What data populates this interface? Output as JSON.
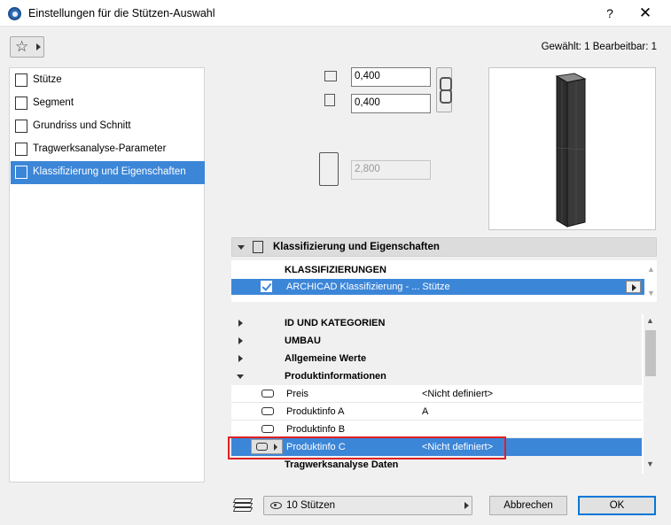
{
  "window": {
    "title": "Einstellungen für die Stützen-Auswahl",
    "help": "?",
    "close": "✕"
  },
  "toolbar": {
    "favorites_icon": "star-icon",
    "selection_info": "Gewählt: 1 Bearbeitbar: 1"
  },
  "nav": {
    "items": [
      {
        "label": "Stütze",
        "icon": "column-icon"
      },
      {
        "label": "Segment",
        "icon": "segment-icon"
      },
      {
        "label": "Grundriss und Schnitt",
        "icon": "floorplan-icon"
      },
      {
        "label": "Tragwerksanalyse-Parameter",
        "icon": "structural-icon"
      },
      {
        "label": "Klassifizierung und Eigenschaften",
        "icon": "classification-icon"
      }
    ],
    "active_index": 4
  },
  "geometry": {
    "width_value": "0,400",
    "depth_value": "0,400",
    "height_value": "2,800"
  },
  "section": {
    "title": "Klassifizierung und Eigenschaften"
  },
  "classification": {
    "header": "KLASSIFIZIERUNGEN",
    "row_label": "ARCHICAD Klassifizierung - ... Stütze",
    "checked": true
  },
  "properties": {
    "groups": [
      {
        "label": "ID UND KATEGORIEN",
        "expanded": false
      },
      {
        "label": "UMBAU",
        "expanded": false
      },
      {
        "label": "Allgemeine Werte",
        "expanded": false
      },
      {
        "label": "Produktinformationen",
        "expanded": true
      }
    ],
    "items": [
      {
        "name": "Preis",
        "value": "<Nicht definiert>"
      },
      {
        "name": "Produktinfo A",
        "value": "A"
      },
      {
        "name": "Produktinfo B",
        "value": ""
      },
      {
        "name": "Produktinfo C",
        "value": "<Nicht definiert>"
      }
    ],
    "last_group": "Tragwerksanalyse Daten",
    "selected_item": "Produktinfo C"
  },
  "footer": {
    "layer_icon": "layers-icon",
    "filter_label": "10 Stützen",
    "cancel_label": "Abbrechen",
    "ok_label": "OK"
  },
  "colors": {
    "selection": "#3c86d8",
    "highlight": "#e02020"
  }
}
